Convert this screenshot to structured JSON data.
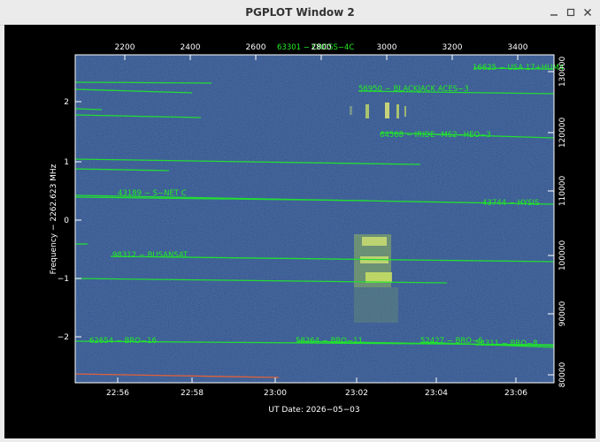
{
  "window": {
    "title": "PGPLOT Window 2",
    "buttons": [
      "minimize",
      "maximize",
      "close"
    ]
  },
  "plot": {
    "top_axis_ticks": [
      "2200",
      "2400",
      "2600",
      "2800",
      "3000",
      "3200",
      "3400"
    ],
    "left_axis_ticks": [
      "2",
      "1",
      "0",
      "−1",
      "−2"
    ],
    "right_axis_ticks": [
      "130000",
      "120000",
      "110000",
      "100000",
      "90000",
      "80000"
    ],
    "bottom_axis_ticks": [
      "22:56",
      "22:58",
      "23:00",
      "23:02",
      "23:04",
      "23:06"
    ],
    "ylabel": "Frequency − 2262.623 MHz",
    "xlabel": "UT Date: 2026−05−03",
    "satellite_labels": [
      "63301 − CROSS−4C",
      "16625 − USA 17+HUM4",
      "56950 − BLACKJACK ACES−3",
      "64568 − IRIDE−MS2−HEO−3",
      "43189 − S−NET C",
      "43744 − HYSIS",
      "98312 − BUSANSAT",
      "62654 − BRO−16",
      "58264 − BRO−11",
      "52427 − BRO−6",
      "58311 − BRO−8"
    ],
    "colors": {
      "background": "#000000",
      "waterfall": "#2f4f88",
      "track": "#22dd33",
      "label": "#22ee22",
      "axis": "#ffffff",
      "red_track": "#e0603a"
    }
  }
}
